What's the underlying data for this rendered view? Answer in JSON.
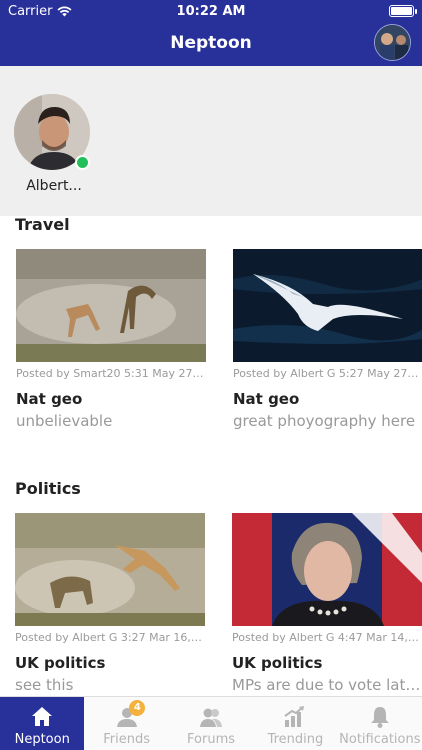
{
  "status_bar": {
    "carrier": "Carrier",
    "time": "10:22 AM"
  },
  "header": {
    "title": "Neptoon"
  },
  "stories": [
    {
      "name": "Albert..."
    }
  ],
  "sections": [
    {
      "title": "Travel",
      "posts": [
        {
          "meta": "Posted by Smart20 5:31 May 27,2...",
          "title": "Nat geo",
          "desc": "unbelievable"
        },
        {
          "meta": "Posted by Albert G 5:27 May 27,2...",
          "title": "Nat geo",
          "desc": "great phoyography here"
        }
      ]
    },
    {
      "title": "Politics",
      "posts": [
        {
          "meta": "Posted by Albert G 3:27 Mar 16,2...",
          "title": "UK politics",
          "desc": "see this"
        },
        {
          "meta": "Posted by Albert G 4:47 Mar 14,2...",
          "title": "UK politics",
          "desc": "MPs are due to vote later on the third..."
        }
      ]
    }
  ],
  "tabbar": {
    "tabs": [
      {
        "label": "Neptoon",
        "icon": "home-icon"
      },
      {
        "label": "Friends",
        "icon": "friends-icon",
        "badge": "4"
      },
      {
        "label": "Forums",
        "icon": "forums-icon"
      },
      {
        "label": "Trending",
        "icon": "trending-icon"
      },
      {
        "label": "Notifications",
        "icon": "bell-icon"
      }
    ]
  },
  "colors": {
    "brand": "#28309a",
    "online": "#22c05a",
    "badge": "#f4b13c"
  }
}
